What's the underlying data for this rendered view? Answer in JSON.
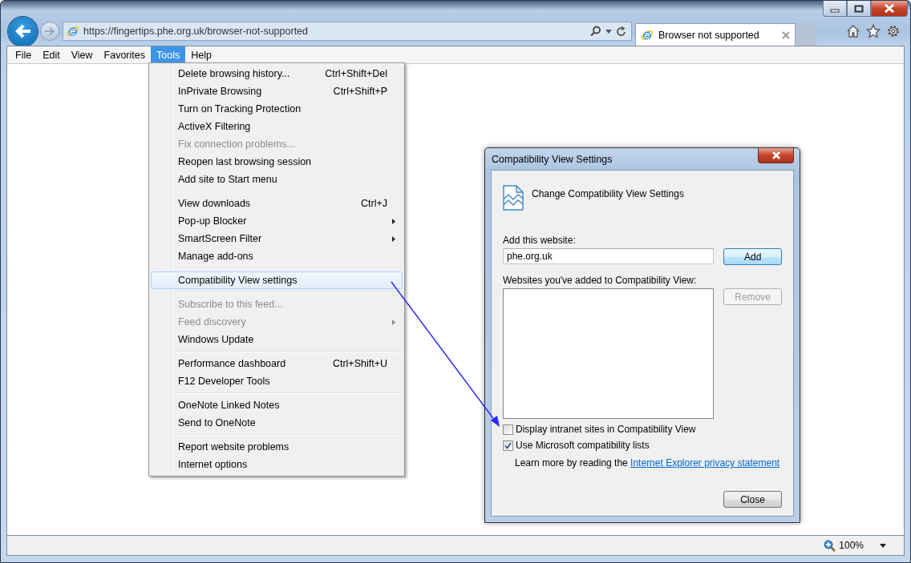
{
  "address_bar": {
    "url": "https://fingertips.phe.org.uk/browser-not-supported"
  },
  "tabs": [
    {
      "title": "Browser not supported",
      "selected": true
    }
  ],
  "menu_bar": [
    {
      "label": "File",
      "selected": false
    },
    {
      "label": "Edit",
      "selected": false
    },
    {
      "label": "View",
      "selected": false
    },
    {
      "label": "Favorites",
      "selected": false
    },
    {
      "label": "Tools",
      "selected": true
    },
    {
      "label": "Help",
      "selected": false
    }
  ],
  "tools_menu": {
    "groups": [
      {
        "items": [
          {
            "label": "Delete browsing history...",
            "shortcut": "Ctrl+Shift+Del",
            "disabled": false,
            "submenu": false,
            "selected": false
          },
          {
            "label": "InPrivate Browsing",
            "shortcut": "Ctrl+Shift+P",
            "disabled": false,
            "submenu": false,
            "selected": false
          },
          {
            "label": "Turn on Tracking Protection",
            "disabled": false,
            "submenu": false,
            "selected": false
          },
          {
            "label": "ActiveX Filtering",
            "disabled": false,
            "submenu": false,
            "selected": false
          },
          {
            "label": "Fix connection problems...",
            "disabled": true,
            "submenu": false,
            "selected": false
          },
          {
            "label": "Reopen last browsing session",
            "disabled": false,
            "submenu": false,
            "selected": false
          },
          {
            "label": "Add site to Start menu",
            "disabled": false,
            "submenu": false,
            "selected": false
          }
        ]
      },
      {
        "items": [
          {
            "label": "View downloads",
            "shortcut": "Ctrl+J",
            "disabled": false,
            "submenu": false,
            "selected": false
          },
          {
            "label": "Pop-up Blocker",
            "disabled": false,
            "submenu": true,
            "selected": false
          },
          {
            "label": "SmartScreen Filter",
            "disabled": false,
            "submenu": true,
            "selected": false
          },
          {
            "label": "Manage add-ons",
            "disabled": false,
            "submenu": false,
            "selected": false
          }
        ]
      },
      {
        "items": [
          {
            "label": "Compatibility View settings",
            "disabled": false,
            "submenu": false,
            "selected": true
          }
        ]
      },
      {
        "items": [
          {
            "label": "Subscribe to this feed...",
            "disabled": true,
            "submenu": false,
            "selected": false
          },
          {
            "label": "Feed discovery",
            "disabled": true,
            "submenu": true,
            "selected": false
          },
          {
            "label": "Windows Update",
            "disabled": false,
            "submenu": false,
            "selected": false
          }
        ]
      },
      {
        "items": [
          {
            "label": "Performance dashboard",
            "shortcut": "Ctrl+Shift+U",
            "disabled": false,
            "submenu": false,
            "selected": false
          },
          {
            "label": "F12 Developer Tools",
            "disabled": false,
            "submenu": false,
            "selected": false
          }
        ]
      },
      {
        "items": [
          {
            "label": "OneNote Linked Notes",
            "disabled": false,
            "submenu": false,
            "selected": false
          },
          {
            "label": "Send to OneNote",
            "disabled": false,
            "submenu": false,
            "selected": false
          }
        ]
      },
      {
        "items": [
          {
            "label": "Report website problems",
            "disabled": false,
            "submenu": false,
            "selected": false
          },
          {
            "label": "Internet options",
            "disabled": false,
            "submenu": false,
            "selected": false
          }
        ]
      }
    ]
  },
  "dialog": {
    "title": "Compatibility View Settings",
    "heading": "Change Compatibility View Settings",
    "add_label": "Add this website:",
    "add_field": {
      "value": "phe.org.uk"
    },
    "add_button": {
      "label": "Add",
      "disabled": false
    },
    "list_label": "Websites you've added to Compatibility View:",
    "remove_button": {
      "label": "Remove",
      "disabled": true
    },
    "options": [
      {
        "label": "Display intranet sites in Compatibility View",
        "checked": false
      },
      {
        "label": "Use Microsoft compatibility lists",
        "checked": true
      }
    ],
    "learn_more": {
      "text": "Learn more by reading the",
      "link": "Internet Explorer privacy statement"
    },
    "close_button": {
      "label": "Close",
      "disabled": false
    }
  },
  "status_bar": {
    "zoom": "100%"
  }
}
